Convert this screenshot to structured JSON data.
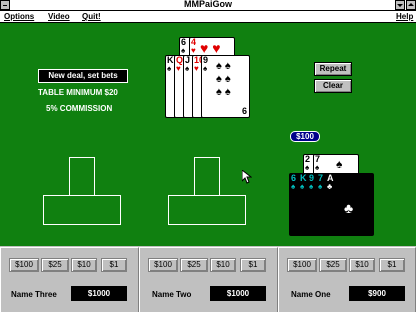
{
  "window": {
    "title": "MMPaiGow"
  },
  "menu": {
    "options": "Options",
    "video": "Video",
    "quit": "Quit!",
    "help": "Help"
  },
  "controls": {
    "new_deal": "New deal, set bets",
    "table_minimum": "TABLE MINIMUM $20",
    "commission": "5% COMMISSION",
    "repeat": "Repeat",
    "clear": "Clear"
  },
  "dealer_hand": {
    "back_cards": [
      {
        "rank": "6",
        "suit": "♠",
        "color": "black"
      },
      {
        "rank": "4",
        "suit": "♥",
        "color": "red"
      }
    ],
    "front_cards": [
      {
        "rank": "K",
        "suit": "♠",
        "color": "black"
      },
      {
        "rank": "Q",
        "suit": "♥",
        "color": "red"
      },
      {
        "rank": "J",
        "suit": "♠",
        "color": "black"
      },
      {
        "rank": "10",
        "suit": "♥",
        "color": "red"
      },
      {
        "rank": "9",
        "suit": "♠",
        "color": "black"
      }
    ],
    "bottom_rank": "6"
  },
  "player_hand": {
    "bet": "$100",
    "back_cards": [
      {
        "rank": "2",
        "suit": "♠"
      },
      {
        "rank": "7",
        "suit": "♠"
      }
    ],
    "front_cards": [
      {
        "rank": "6",
        "suit": "♠"
      },
      {
        "rank": "K",
        "suit": "♠"
      },
      {
        "rank": "9",
        "suit": "♠"
      },
      {
        "rank": "7",
        "suit": "♠"
      },
      {
        "rank": "A",
        "suit": "♣"
      }
    ]
  },
  "players": [
    {
      "name": "Name Three",
      "bankroll": "$1000",
      "chips": [
        "$100",
        "$25",
        "$10",
        "$1"
      ]
    },
    {
      "name": "Name Two",
      "bankroll": "$1000",
      "chips": [
        "$100",
        "$25",
        "$10",
        "$1"
      ]
    },
    {
      "name": "Name One",
      "bankroll": "$900",
      "chips": [
        "$100",
        "$25",
        "$10",
        "$1"
      ]
    }
  ]
}
